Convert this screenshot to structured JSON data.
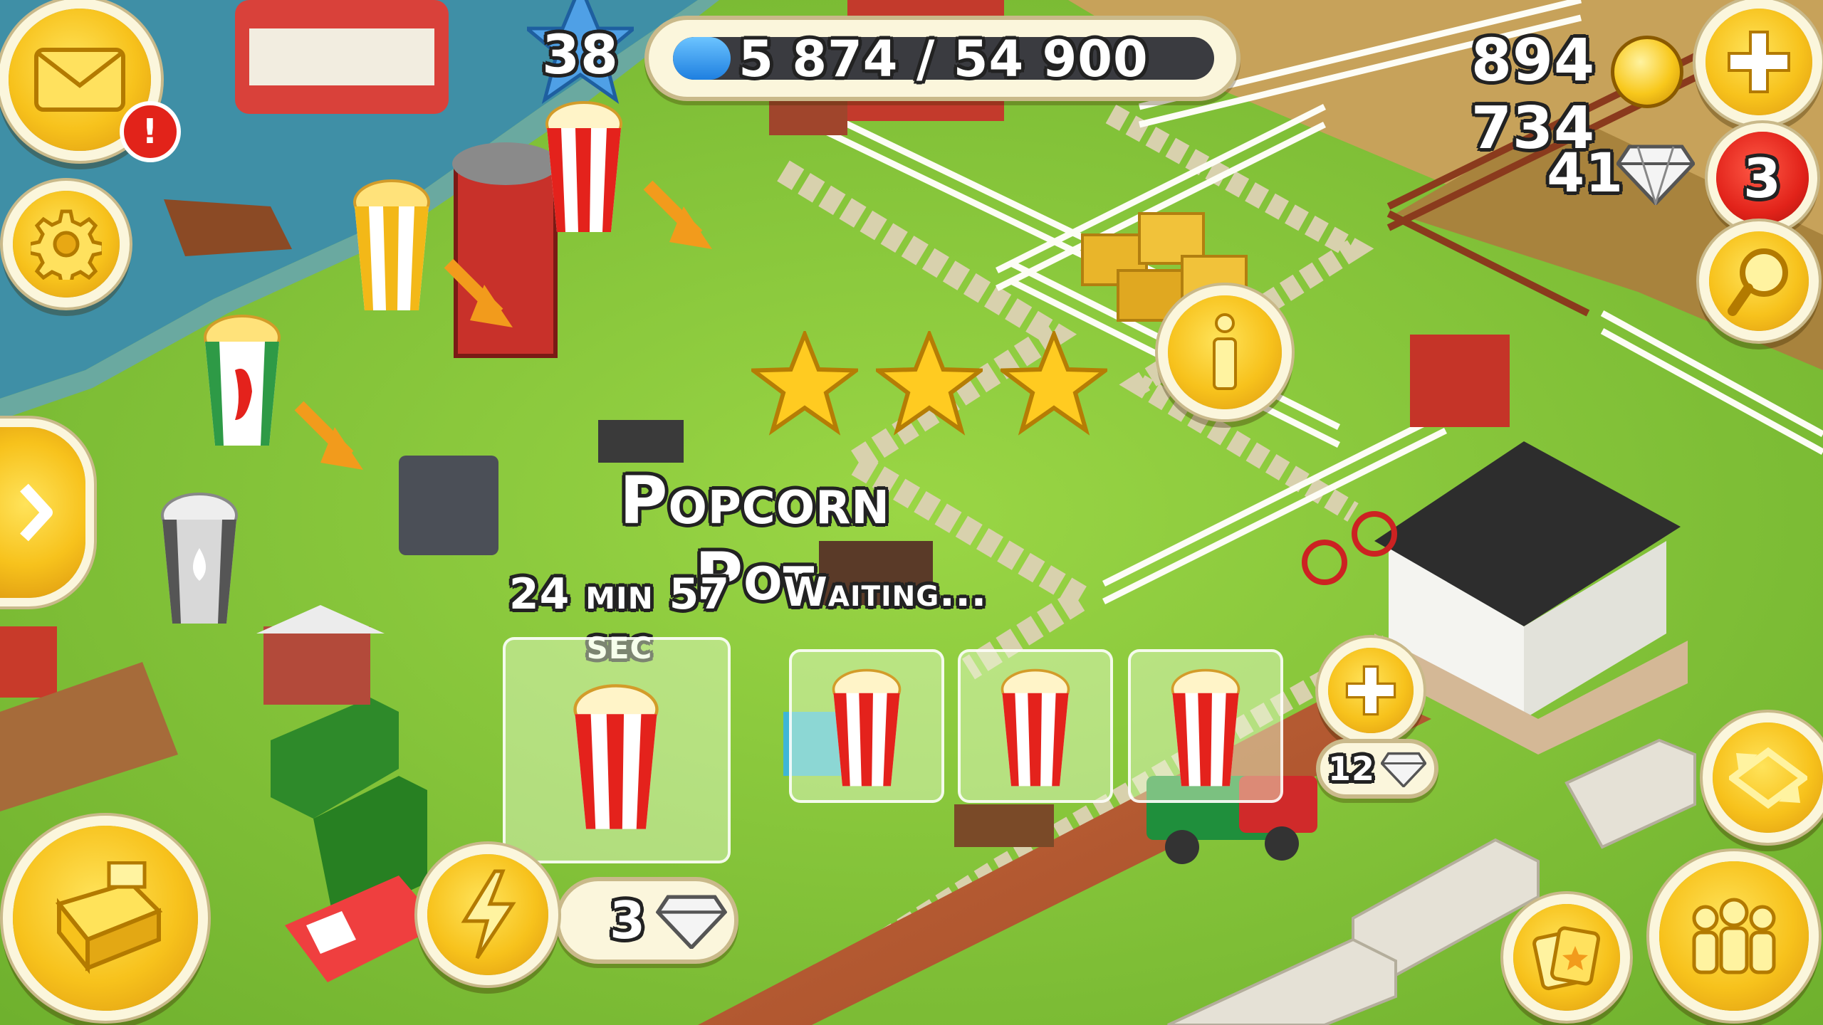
{
  "hud": {
    "level": "38",
    "xp_text": "5 874 / 54 900",
    "xp_progress": 0.107,
    "coins": "894 734",
    "diamonds": "41",
    "notifications": "3",
    "mail_badge": "!"
  },
  "building": {
    "name": "Popcorn Pot",
    "timer": "24 min 57 sec",
    "status": "Waiting..."
  },
  "rush": {
    "cost": "3"
  },
  "add_slot": {
    "cost": "12"
  },
  "stars_count": 3,
  "colors": {
    "gold": "#f7c21c",
    "red": "#e2231a",
    "grass": "#86c83c",
    "road": "#b85a32",
    "cream": "#fbf6dc"
  },
  "icons": {
    "mail": "envelope-icon",
    "settings": "gear-icon",
    "expand": "chevron-right-icon",
    "shop": "cash-register-icon",
    "rush": "lightning-icon",
    "info": "info-icon",
    "add_coins": "plus-icon",
    "search": "magnifier-icon",
    "edit": "arrows-icon",
    "friends": "people-icon",
    "cards": "cards-icon"
  }
}
